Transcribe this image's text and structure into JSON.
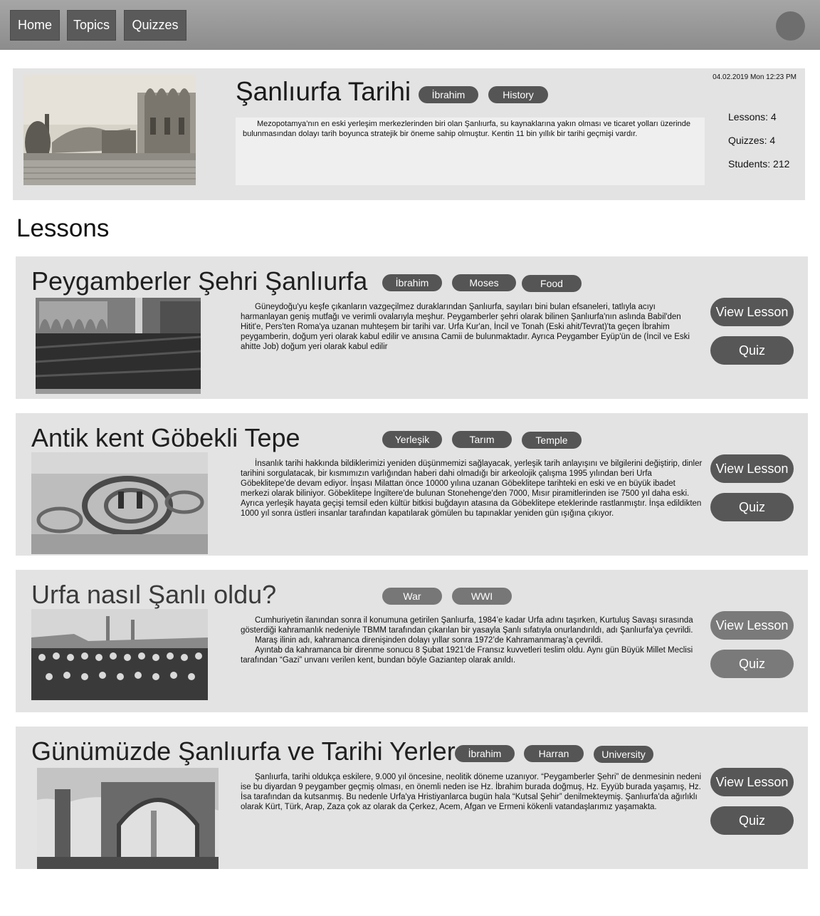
{
  "nav": {
    "items": [
      "Home",
      "Topics",
      "Quizzes"
    ]
  },
  "topic": {
    "title": "Şanlıurfa Tarihi",
    "tags": [
      "İbrahim",
      "History"
    ],
    "date": "04.02.2019 Mon 12:23 PM",
    "description": "Mezopotamya’nın en eski yerleşim merkezlerinden biri olan Şanlıurfa, su kaynaklarına yakın olması ve ticaret yolları üzerinde bulunmasından dolayı tarih boyunca stratejik bir öneme sahip olmuştur. Kentin 11 bin yıllık bir tarihi geçmişi vardır.",
    "stats": [
      "Lessons: 4",
      "Quizzes: 4",
      "Students: 212"
    ]
  },
  "lessons_heading": "Lessons",
  "lessons": [
    {
      "title": "Peygamberler Şehri Şanlıurfa",
      "tags": [
        "İbrahim",
        "Moses",
        "Food"
      ],
      "paragraphs": [
        "Güneydoğu'yu keşfe çıkanların vazgeçilmez duraklarından Şanlıurfa, sayıları bini bulan efsaneleri, tatlıyla acıyı harmanlayan geniş mutfağı ve verimli ovalarıyla meşhur. Peygamberler şehri olarak bilinen Şanlıurfa'nın aslında Babil'den Hitit'e, Pers'ten Roma'ya uzanan muhteşem bir tarihi var. Urfa Kur'an, İncil ve Tonah (Eski ahit/Tevrat)'ta geçen İbrahim peygamberin, doğum yeri olarak kabul edilir ve anısına Camii de bulunmaktadır. Ayrıca Peygamber Eyüp'ün de (İncil ve Eski ahitte Job) doğum yeri olarak kabul edilir"
      ],
      "view_label": "View Lesson",
      "quiz_label": "Quiz"
    },
    {
      "title": "Antik kent Göbekli Tepe",
      "tags": [
        "Yerleşik",
        "Tarım",
        "Temple"
      ],
      "paragraphs": [
        "İnsanlık tarihi hakkında bildiklerimizi yeniden düşünmemizi sağlayacak, yerleşik tarih anlayışını ve bilgilerini değiştirip, dinler tarihini sorgulatacak, bir kısmımızın varlığından haberi dahi olmadığı bir arkeolojik çalışma 1995 yılından beri Urfa Göbeklitepe'de devam ediyor. İnşası Milattan önce 10000 yılına uzanan Göbeklitepe tarihteki en eski ve en büyük ibadet merkezi olarak biliniyor. Göbeklitepe İngiltere'de bulunan Stonehenge'den 7000, Mısır piramitlerinden ise 7500 yıl daha eski. Ayrıca yerleşik hayata geçişi temsil eden kültür bitkisi buğdayın atasına da Göbeklitepe eteklerinde rastlanmıştır. İnşa edildikten 1000 yıl sonra üstleri insanlar tarafından kapatılarak gömülen bu tapınaklar yeniden gün ışığına çıkıyor."
      ],
      "view_label": "View Lesson",
      "quiz_label": "Quiz"
    },
    {
      "title": "Urfa nasıl Şanlı oldu?",
      "tags": [
        "War",
        "WWI"
      ],
      "paragraphs": [
        "Cumhuriyetin ilanından sonra il konumuna getirilen Şanlıurfa, 1984’e kadar Urfa adını taşırken, Kurtuluş Savaşı sırasında gösterdiği kahramanlık nedeniyle TBMM tarafından çıkarılan bir yasayla Şanlı sıfatıyla onurlandırıldı, adı Şanlıurfa'ya çevrildi.",
        "Maraş ilinin adı, kahramanca direnişinden dolayı yıllar sonra 1972’de Kahramanmaraş’a çevrildi.",
        "Ayıntab da kahramanca bir direnme sonucu 8 Şubat 1921’de Fransız kuvvetleri teslim oldu. Aynı gün Büyük Millet Meclisi tarafından “Gazi” unvanı verilen kent, bundan böyle Gaziantep olarak anıldı."
      ],
      "view_label": "View Lesson",
      "quiz_label": "Quiz"
    },
    {
      "title": "Günümüzde Şanlıurfa ve Tarihi Yerler",
      "tags": [
        "İbrahim",
        "Harran",
        "University"
      ],
      "paragraphs": [
        "Şanlıurfa, tarihi oldukça eskilere, 9.000 yıl öncesine, neolitik döneme uzanıyor. “Peygamberler Şehri” de denmesinin nedeni ise bu diyardan 9 peygamber geçmiş olması, en önemli neden ise Hz. İbrahim burada doğmuş, Hz. Eyyüb burada yaşamış, Hz. İsa tarafından da kutsanmış. Bu nedenle Urfa'ya Hristiyanlarca bugün hala “Kutsal Şehir” denilmekteymiş. Şanlıurfa'da ağırlıklı olarak Kürt, Türk, Arap, Zaza çok az olarak da Çerkez, Acem, Afgan ve Ermeni kökenli vatandaşlarımız yaşamakta."
      ],
      "view_label": "View Lesson",
      "quiz_label": "Quiz"
    }
  ]
}
